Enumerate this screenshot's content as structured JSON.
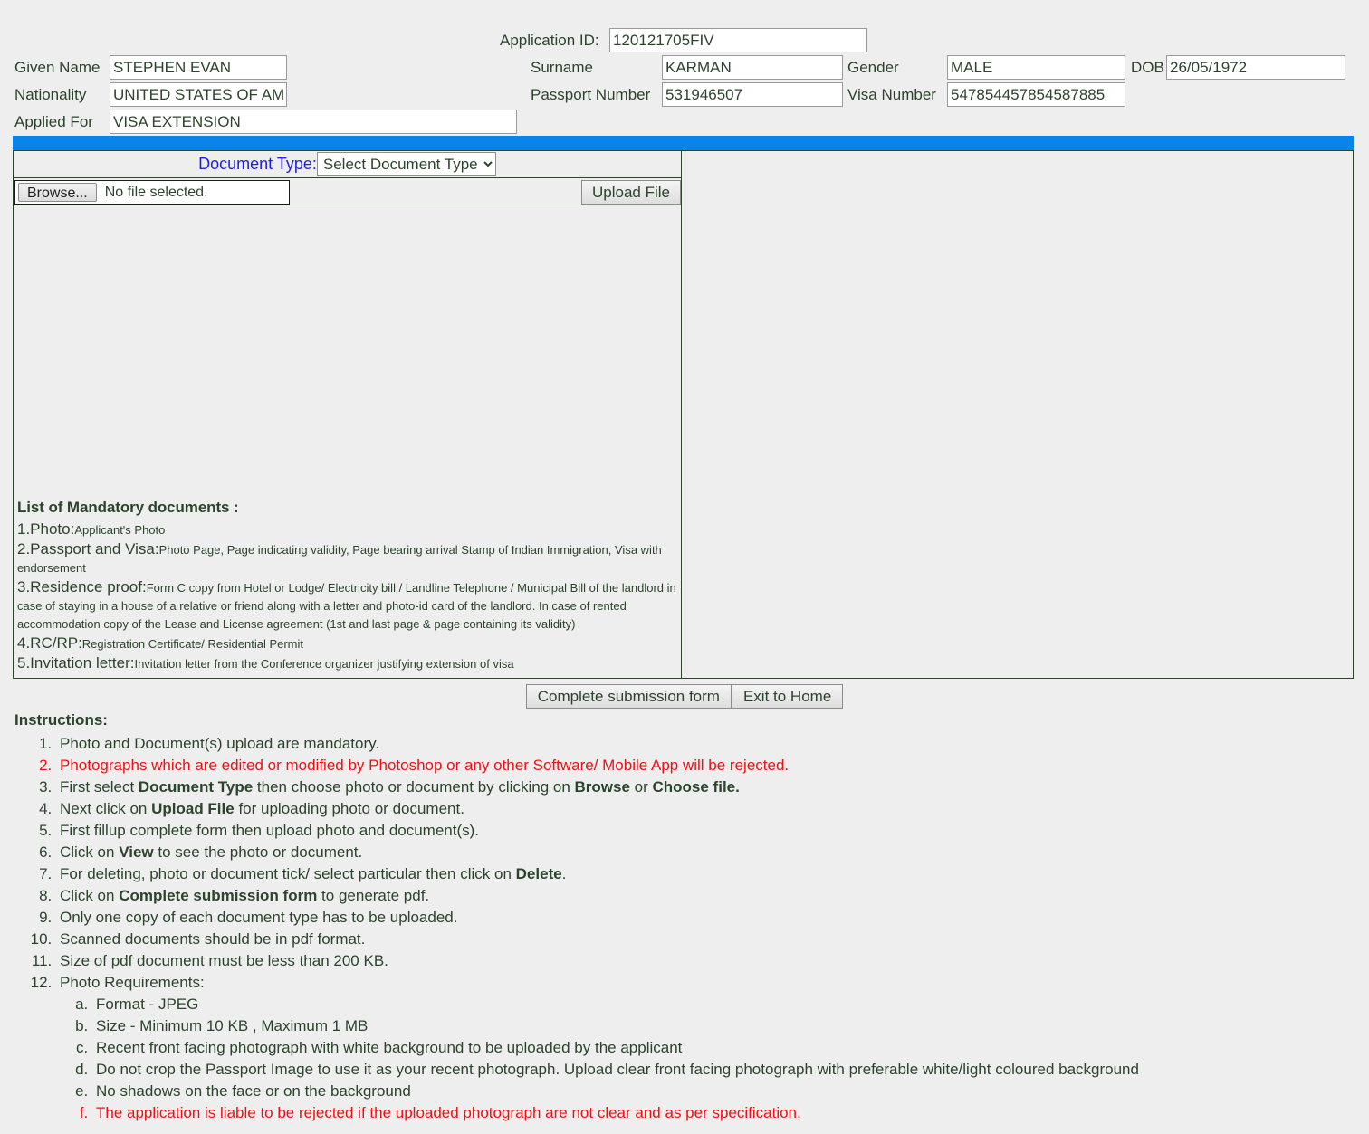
{
  "header": {
    "application_id_label": "Application ID:",
    "application_id_value": "120121705FIV",
    "given_name_label": "Given Name",
    "given_name_value": "STEPHEN EVAN",
    "surname_label": "Surname",
    "surname_value": "KARMAN",
    "gender_label": "Gender",
    "gender_value": "MALE",
    "dob_label": "DOB",
    "dob_value": "26/05/1972",
    "nationality_label": "Nationality",
    "nationality_value": "UNITED STATES OF AM",
    "passport_number_label": "Passport Number",
    "passport_number_value": "531946507",
    "visa_number_label": "Visa Number",
    "visa_number_value": "547854457854587885",
    "applied_for_label": "Applied For",
    "applied_for_value": "VISA EXTENSION"
  },
  "upload": {
    "document_type_label": "Document Type:",
    "document_type_selected": "Select Document Type",
    "document_type_options": [
      "Select Document Type"
    ],
    "browse_label": "Browse...",
    "no_file_text": "No file selected.",
    "upload_button_label": "Upload File"
  },
  "mandatory": {
    "title": "List of Mandatory documents :",
    "items": [
      {
        "num": "1.Photo:",
        "desc": "Applicant's Photo"
      },
      {
        "num": "2.Passport and Visa:",
        "desc": "Photo Page, Page indicating validity, Page bearing arrival Stamp of Indian Immigration, Visa with endorsement"
      },
      {
        "num": "3.Residence proof:",
        "desc": "Form C copy from Hotel or Lodge/ Electricity bill / Landline Telephone / Municipal Bill of the landlord in case of staying in a house of a relative or friend along with a letter and photo-id card of the landlord. In case of rented accommodation copy of the Lease and License agreement (1st and last page & page containing its validity)"
      },
      {
        "num": "4.RC/RP:",
        "desc": "Registration Certificate/ Residential Permit"
      },
      {
        "num": "5.Invitation letter:",
        "desc": "Invitation letter from the Conference organizer justifying extension of visa"
      }
    ]
  },
  "actions": {
    "complete_label": "Complete submission form",
    "exit_label": "Exit to Home"
  },
  "instructions": {
    "title": "Instructions:",
    "items": [
      {
        "text": "Photo and Document(s) upload are mandatory.",
        "red": false
      },
      {
        "text": "Photographs which are edited or modified by Photoshop or any other Software/ Mobile App will be rejected.",
        "red": true
      },
      {
        "html": "First select <b>Document Type</b> then choose photo or document by clicking on <b>Browse</b> or <b>Choose file.</b>",
        "red": false
      },
      {
        "html": "Next click on <b>Upload File</b> for uploading photo or document.",
        "red": false
      },
      {
        "text": "First fillup complete form then upload photo and document(s).",
        "red": false
      },
      {
        "html": "Click on <b>View</b> to see the photo or document.",
        "red": false
      },
      {
        "html": "For deleting, photo or document tick/ select particular then click on <b>Delete</b>.",
        "red": false
      },
      {
        "html": "Click on <b>Complete submission form</b> to generate pdf.",
        "red": false
      },
      {
        "text": "Only one copy of each document type has to be uploaded.",
        "red": false
      },
      {
        "text": "Scanned documents should be in pdf format.",
        "red": false
      },
      {
        "text": "Size of pdf document must be less than 200 KB.",
        "red": false
      },
      {
        "text": "Photo Requirements:",
        "red": false,
        "sub": [
          {
            "text": "Format - JPEG",
            "red": false
          },
          {
            "text": "Size - Minimum 10 KB , Maximum 1 MB",
            "red": false
          },
          {
            "text": "Recent front facing photograph with white background to be uploaded by the applicant",
            "red": false
          },
          {
            "text": "Do not crop the Passport Image to use it as your recent photograph. Upload clear front facing photograph with preferable white/light coloured background",
            "red": false
          },
          {
            "text": "No shadows on the face or on the background",
            "red": false
          },
          {
            "text": "The application is liable to be rejected if the uploaded photograph are not clear and as per specification.",
            "red": true
          }
        ]
      }
    ]
  },
  "colors": {
    "blue_bar": "#0a84e8",
    "text_green": "#2c442c",
    "label_blue": "#1f1fe0",
    "error_red": "#ee1111",
    "page_bg": "#eeeeee"
  }
}
